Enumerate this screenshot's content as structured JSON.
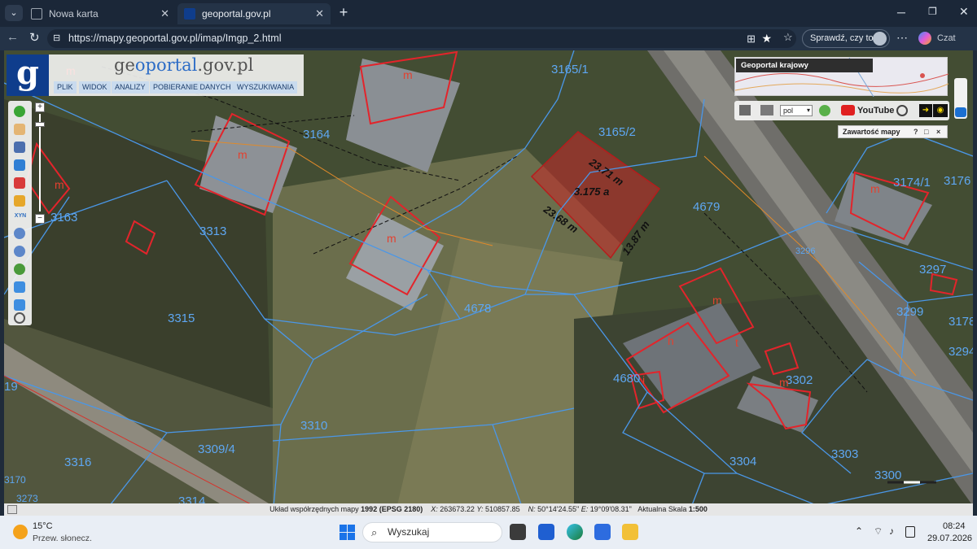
{
  "browser": {
    "tabs": [
      {
        "label": "Nowa karta"
      },
      {
        "label": "geoportal.gov.pl"
      }
    ],
    "url": "https://mapy.geoportal.gov.pl/imap/Imgp_2.html",
    "sprawdz_label": "Sprawdź, czy to Ty",
    "czat_label": "Czat"
  },
  "app": {
    "logo_letter": "g",
    "title_prefix": "ge",
    "title_core": "oportal",
    "title_suffix": ".gov.pl",
    "menu": [
      "PLIK",
      "WIDOK",
      "ANALIZY",
      "POBIERANIE DANYCH",
      "WYSZUKIWANIA"
    ],
    "overview_label": "Geoportal krajowy",
    "lang_select": "pol",
    "youtube_label": "YouTube",
    "zawartosc_label": "Zawartość mapy",
    "zawartosc_controls": [
      "?",
      "□",
      "×"
    ],
    "xyn_tool": "XYN"
  },
  "map": {
    "parcels": [
      "3165/1",
      "3165/2",
      "3164",
      "3163",
      "3313",
      "3315",
      "4679",
      "4678",
      "3174/1",
      "3176",
      "3297",
      "3299",
      "3178",
      "3294",
      "4680",
      "3302",
      "3310",
      "3309/4",
      "3316",
      "3314",
      "3304",
      "3303",
      "3300",
      "3296",
      "19",
      "3170",
      "3273",
      "3310"
    ],
    "buildings": [
      "m",
      "m",
      "m",
      "m",
      "m",
      "m",
      "h",
      "t",
      "i",
      "m",
      "m"
    ],
    "selected_area": "3.175 a",
    "measurements": [
      "23.71 m",
      "23.68 m",
      "13.87 m"
    ],
    "scale_bar": "|"
  },
  "statusbar": {
    "crs_label": "Układ współrzędnych mapy",
    "crs_value": "1992 (EPSG 2180)",
    "x_label": "X:",
    "x_value": "263673.22",
    "y_label": "Y:",
    "y_value": "510857.85",
    "n_label": "N:",
    "n_value": "50°14'24.55\"",
    "e_label": "E:",
    "e_value": "19°09'08.31\"",
    "scale_label": "Aktualna Skala",
    "scale_value": "1:500"
  },
  "taskbar": {
    "weather_temp": "15°C",
    "weather_desc": "Przew. słonecz.",
    "search_placeholder": "Wyszukaj",
    "time": "08:24",
    "date": "29.07.2026"
  }
}
